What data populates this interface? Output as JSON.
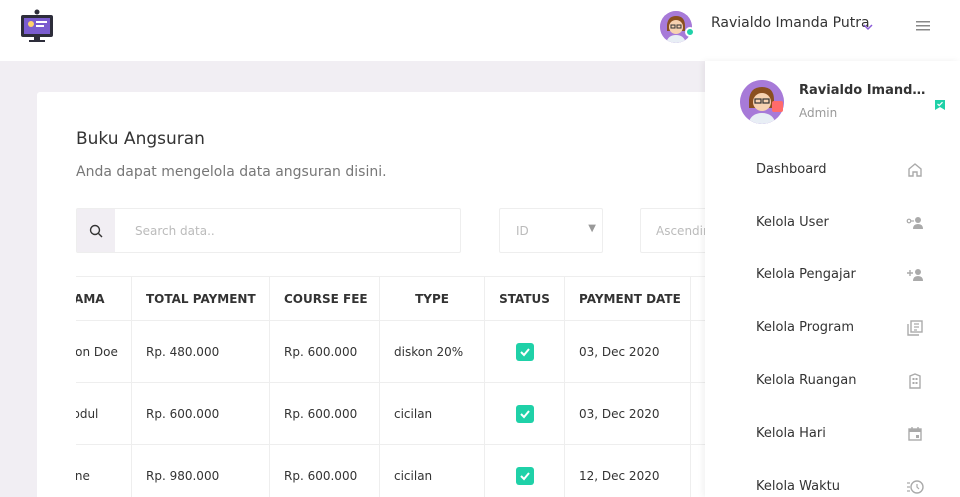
{
  "header": {
    "user_name": "Ravialdo Imanda Putra",
    "icons": [
      "app-logo-icon",
      "chevron-down-icon",
      "hamburger-menu-icon"
    ]
  },
  "page": {
    "title": "Buku Angsuran",
    "subtitle": "Anda dapat mengelola data angsuran disini."
  },
  "filters": {
    "search_placeholder": "Search data..",
    "id_select": "ID",
    "order_select": "Ascending"
  },
  "table": {
    "columns": [
      "NAMA",
      "TOTAL PAYMENT",
      "COURSE FEE",
      "TYPE",
      "STATUS",
      "PAYMENT DATE"
    ],
    "rows": [
      {
        "nama": "Jhon Doe",
        "total_payment": "Rp. 480.000",
        "course_fee": "Rp. 600.000",
        "type": "diskon 20%",
        "status": "checked",
        "payment_date": "03, Dec 2020"
      },
      {
        "nama": "Abdul",
        "total_payment": "Rp. 600.000",
        "course_fee": "Rp. 600.000",
        "type": "cicilan",
        "status": "checked",
        "payment_date": "03, Dec 2020"
      },
      {
        "nama": "Jane",
        "total_payment": "Rp. 980.000",
        "course_fee": "Rp. 600.000",
        "type": "cicilan",
        "status": "checked",
        "payment_date": "12, Dec 2020"
      }
    ]
  },
  "sidebar": {
    "name": "Ravialdo Imanda Putra",
    "role": "Admin",
    "items": [
      {
        "label": "Dashboard",
        "icon": "home-icon"
      },
      {
        "label": "Kelola User",
        "icon": "user-key-icon"
      },
      {
        "label": "Kelola Pengajar",
        "icon": "user-add-icon"
      },
      {
        "label": "Kelola Program",
        "icon": "library-books-icon"
      },
      {
        "label": "Kelola Ruangan",
        "icon": "building-icon"
      },
      {
        "label": "Kelola Hari",
        "icon": "calendar-icon"
      },
      {
        "label": "Kelola Waktu",
        "icon": "history-icon"
      }
    ]
  },
  "colors": {
    "background": "#f1eef3",
    "accent": "#1fd1a8",
    "avatar": "#a77ad8"
  }
}
